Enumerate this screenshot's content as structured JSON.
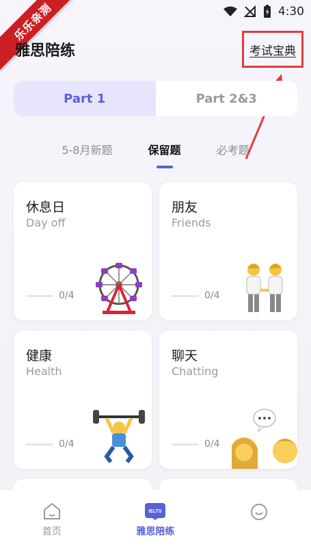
{
  "status_bar": {
    "time": "4:30"
  },
  "watermark": {
    "text": "乐乐亲测"
  },
  "header": {
    "title": "雅思陪练",
    "guide_link": "考试宝典"
  },
  "part_tabs": [
    {
      "label": "Part 1",
      "active": true
    },
    {
      "label": "Part 2&3",
      "active": false
    }
  ],
  "sub_tabs": [
    {
      "label": "5-8月新题",
      "active": false
    },
    {
      "label": "保留题",
      "active": true
    },
    {
      "label": "必考题",
      "active": false
    }
  ],
  "topics": [
    {
      "title_zh": "休息日",
      "title_en": "Day off",
      "progress": "0/4",
      "icon": "ferris-wheel-icon"
    },
    {
      "title_zh": "朋友",
      "title_en": "Friends",
      "progress": "0/4",
      "icon": "two-people-icon"
    },
    {
      "title_zh": "健康",
      "title_en": "Health",
      "progress": "0/4",
      "icon": "weightlifter-icon"
    },
    {
      "title_zh": "聊天",
      "title_en": "Chatting",
      "progress": "0/4",
      "icon": "chat-people-icon"
    }
  ],
  "bottom_nav": [
    {
      "label": "首页",
      "icon": "home-icon",
      "active": false
    },
    {
      "label": "雅思陪练",
      "icon": "ielts-icon",
      "badge": "IELTS",
      "active": true
    },
    {
      "label": "",
      "icon": "profile-icon",
      "active": false
    }
  ],
  "colors": {
    "accent": "#5861d8",
    "watermark": "#cc1f24",
    "highlight_box": "#e23c3c"
  }
}
